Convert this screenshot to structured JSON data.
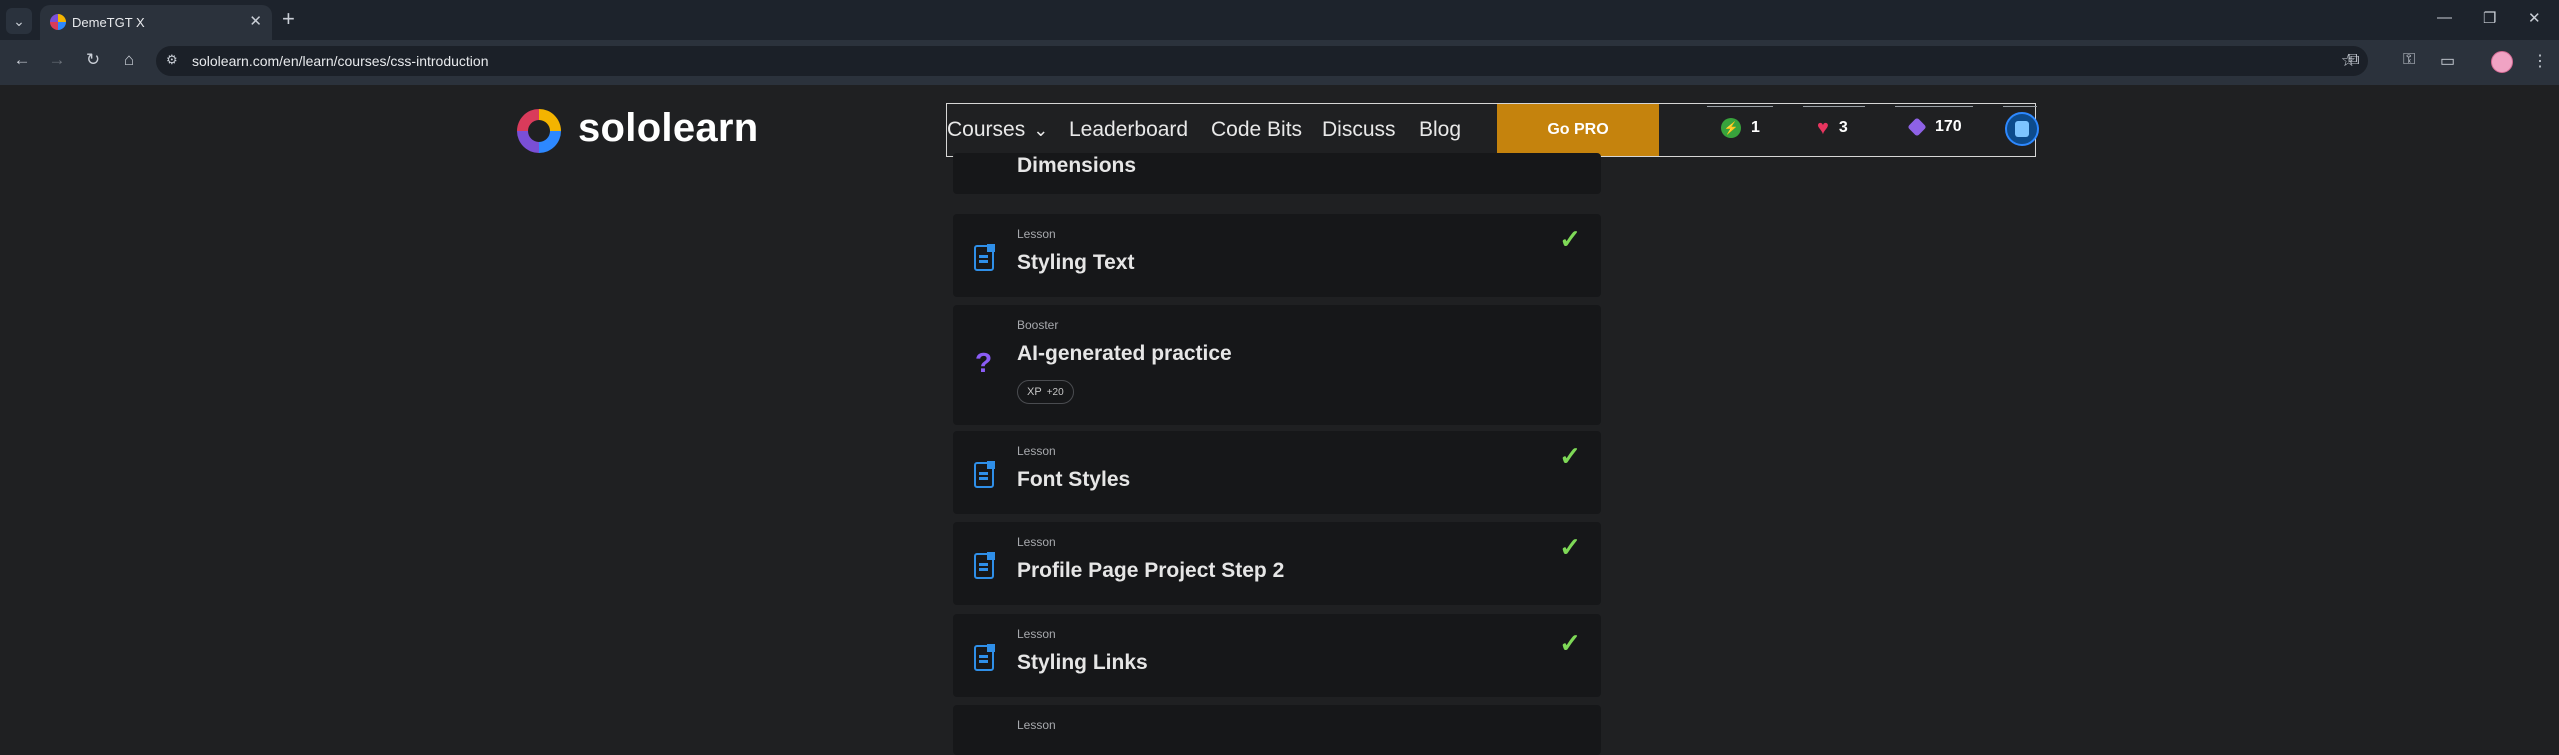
{
  "browser": {
    "tab_title": "DemeTGT X",
    "url": "sololearn.com/en/learn/courses/css-introduction"
  },
  "site": {
    "logo_text": "sololearn",
    "nav": {
      "courses": "Courses",
      "leaderboard": "Leaderboard",
      "code_bits": "Code Bits",
      "discuss": "Discuss",
      "blog": "Blog",
      "go_pro": "Go PRO"
    },
    "stats": {
      "streak": "1",
      "hearts": "3",
      "gems": "170"
    }
  },
  "lessons": [
    {
      "type": "",
      "title": "Dimensions",
      "completed": false
    },
    {
      "type": "Lesson",
      "title": "Styling Text",
      "completed": true
    },
    {
      "type": "Booster",
      "title": "AI-generated practice",
      "xp_label": "XP",
      "xp_value": "+20",
      "completed": false
    },
    {
      "type": "Lesson",
      "title": "Font Styles",
      "completed": true
    },
    {
      "type": "Lesson",
      "title": "Profile Page Project Step 2",
      "completed": true
    },
    {
      "type": "Lesson",
      "title": "Styling Links",
      "completed": true
    },
    {
      "type": "Lesson",
      "title": "",
      "completed": false
    }
  ],
  "colors": {
    "accent_blue": "#2f8fe8",
    "check_green": "#7ed957",
    "pro_orange": "#c5830d",
    "booster_purple": "#8b5cf6"
  },
  "icons": {
    "lesson": "document-icon",
    "booster": "question-mark-icon",
    "done": "checkmark-icon"
  }
}
